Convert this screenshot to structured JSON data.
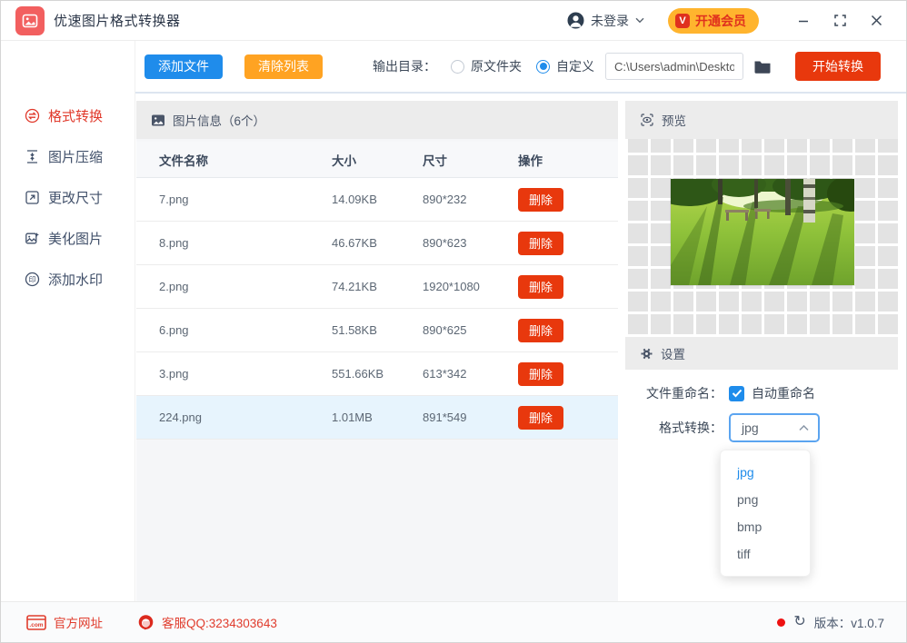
{
  "titlebar": {
    "title": "优速图片格式转换器",
    "login_label": "未登录",
    "vip_label": "开通会员",
    "vip_icon_text": "V"
  },
  "toolbar": {
    "add_files": "添加文件",
    "clear_list": "清除列表",
    "output_dir_label": "输出目录：",
    "radio_original": "原文件夹",
    "radio_custom": "自定义",
    "custom_selected": true,
    "output_path": "C:\\Users\\admin\\Deskto",
    "start_convert": "开始转换"
  },
  "sidebar": {
    "items": [
      {
        "label": "格式转换",
        "icon": "convert-icon",
        "active": true
      },
      {
        "label": "图片压缩",
        "icon": "compress-icon",
        "active": false
      },
      {
        "label": "更改尺寸",
        "icon": "resize-icon",
        "active": false
      },
      {
        "label": "美化图片",
        "icon": "beautify-icon",
        "active": false
      },
      {
        "label": "添加水印",
        "icon": "watermark-icon",
        "active": false
      }
    ],
    "watermark_glyph": "印"
  },
  "file_table": {
    "section_title": "图片信息（6个）",
    "columns": [
      "文件名称",
      "大小",
      "尺寸",
      "操作"
    ],
    "delete_label": "删除",
    "selected_row": 5,
    "rows": [
      {
        "name": "7.png",
        "size": "14.09KB",
        "dimensions": "890*232"
      },
      {
        "name": "8.png",
        "size": "46.67KB",
        "dimensions": "890*623"
      },
      {
        "name": "2.png",
        "size": "74.21KB",
        "dimensions": "1920*1080"
      },
      {
        "name": "6.png",
        "size": "51.58KB",
        "dimensions": "890*625"
      },
      {
        "name": "3.png",
        "size": "551.66KB",
        "dimensions": "613*342"
      },
      {
        "name": "224.png",
        "size": "1.01MB",
        "dimensions": "891*549"
      }
    ]
  },
  "preview": {
    "section_title": "预览"
  },
  "settings": {
    "section_title": "设置",
    "rename_label": "文件重命名：",
    "rename_option": "自动重命名",
    "rename_checked": true,
    "format_label": "格式转换：",
    "format_value": "jpg",
    "format_options": [
      "jpg",
      "png",
      "bmp",
      "tiff"
    ],
    "selected_option_index": 0
  },
  "footer": {
    "website": "官方网址",
    "website_icon_text": ".com",
    "qq": "客服QQ:3234303643",
    "version": "版本：v1.0.7"
  },
  "colors": {
    "brand_red": "#f25f5f",
    "accent_blue": "#1f8ceb",
    "accent_orange": "#ffa322",
    "accent_red": "#e8380d",
    "vip_bg": "#ffb42e",
    "vip_text": "#e0301e",
    "menu_active": "#e0382a",
    "selected_row_bg": "#e7f4fd",
    "section_header_bg": "#ececec",
    "footer_link": "#e03c2d"
  }
}
